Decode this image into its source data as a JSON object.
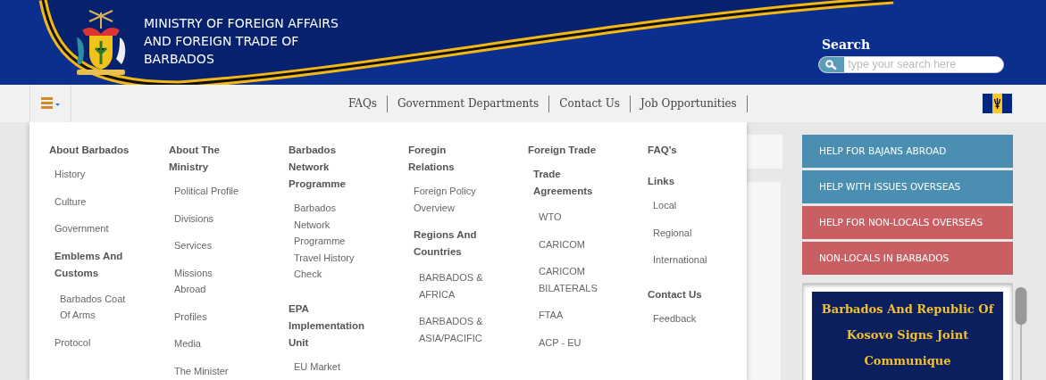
{
  "header": {
    "title_lines": [
      "MINISTRY OF FOREIGN AFFAIRS",
      "AND FOREIGN TRADE OF",
      "BARBADOS"
    ],
    "search": {
      "label": "Search",
      "placeholder": "type your search here"
    }
  },
  "nav": {
    "links": [
      "FAQs",
      "Government Departments",
      "Contact Us",
      "Job Opportunities"
    ]
  },
  "mega_menu": {
    "columns": [
      {
        "sections": [
          {
            "heading": "About Barbados",
            "items": [
              {
                "text": "History"
              },
              {
                "text": "Culture"
              },
              {
                "text": "Government"
              },
              {
                "text": "Emblems And Customs",
                "children": [
                  {
                    "text": "Barbados Coat Of Arms"
                  }
                ]
              },
              {
                "text": "Protocol"
              }
            ]
          }
        ]
      },
      {
        "sections": [
          {
            "heading": "About The Ministry",
            "items": [
              {
                "text": "Political Profile"
              },
              {
                "text": "Divisions"
              },
              {
                "text": "Services"
              },
              {
                "text": "Missions Abroad"
              },
              {
                "text": "Profiles"
              },
              {
                "text": "Media"
              },
              {
                "text": "The Minister"
              }
            ]
          }
        ]
      },
      {
        "sections": [
          {
            "heading": "Barbados Network Programme",
            "items": [
              {
                "text": "Barbados Network Programme Travel History Check"
              }
            ]
          },
          {
            "heading": "EPA Implementation Unit",
            "items": [
              {
                "text": "EU Market"
              }
            ]
          }
        ]
      },
      {
        "sections": [
          {
            "heading": "Foregin Relations",
            "items": [
              {
                "text": "Foreign Policy Overview"
              },
              {
                "text": "Regions And Countries",
                "children": [
                  {
                    "text": "BARBADOS & AFRICA"
                  },
                  {
                    "text": "BARBADOS & ASIA/PACIFIC"
                  }
                ]
              }
            ]
          }
        ]
      },
      {
        "sections": [
          {
            "heading": "Foreign Trade",
            "items": [
              {
                "text": "Trade Agreements",
                "children": [
                  {
                    "text": "WTO"
                  },
                  {
                    "text": "CARICOM"
                  },
                  {
                    "text": "CARICOM BILATERALS"
                  },
                  {
                    "text": "FTAA"
                  },
                  {
                    "text": "ACP - EU"
                  }
                ]
              }
            ]
          }
        ]
      },
      {
        "sections": [
          {
            "heading": "FAQ's"
          },
          {
            "heading": "Links",
            "items": [
              {
                "text": "Local"
              },
              {
                "text": "Regional"
              },
              {
                "text": "International"
              }
            ]
          },
          {
            "heading": "Contact Us",
            "items": [
              {
                "text": "Feedback"
              }
            ]
          }
        ]
      }
    ]
  },
  "sidebar": {
    "buttons": [
      {
        "label": "HELP FOR BAJANS ABROAD",
        "color": "#4a8fb2"
      },
      {
        "label": "HELP WITH ISSUES OVERSEAS",
        "color": "#4a8fb2"
      },
      {
        "label": "HELP FOR NON-LOCALS OVERSEAS",
        "color": "#c95f62"
      },
      {
        "label": "NON-LOCALS IN BARBADOS",
        "color": "#c95f62"
      }
    ],
    "news": {
      "headline": "Barbados And Republic Of Kosovo Signs Joint Communique"
    }
  }
}
